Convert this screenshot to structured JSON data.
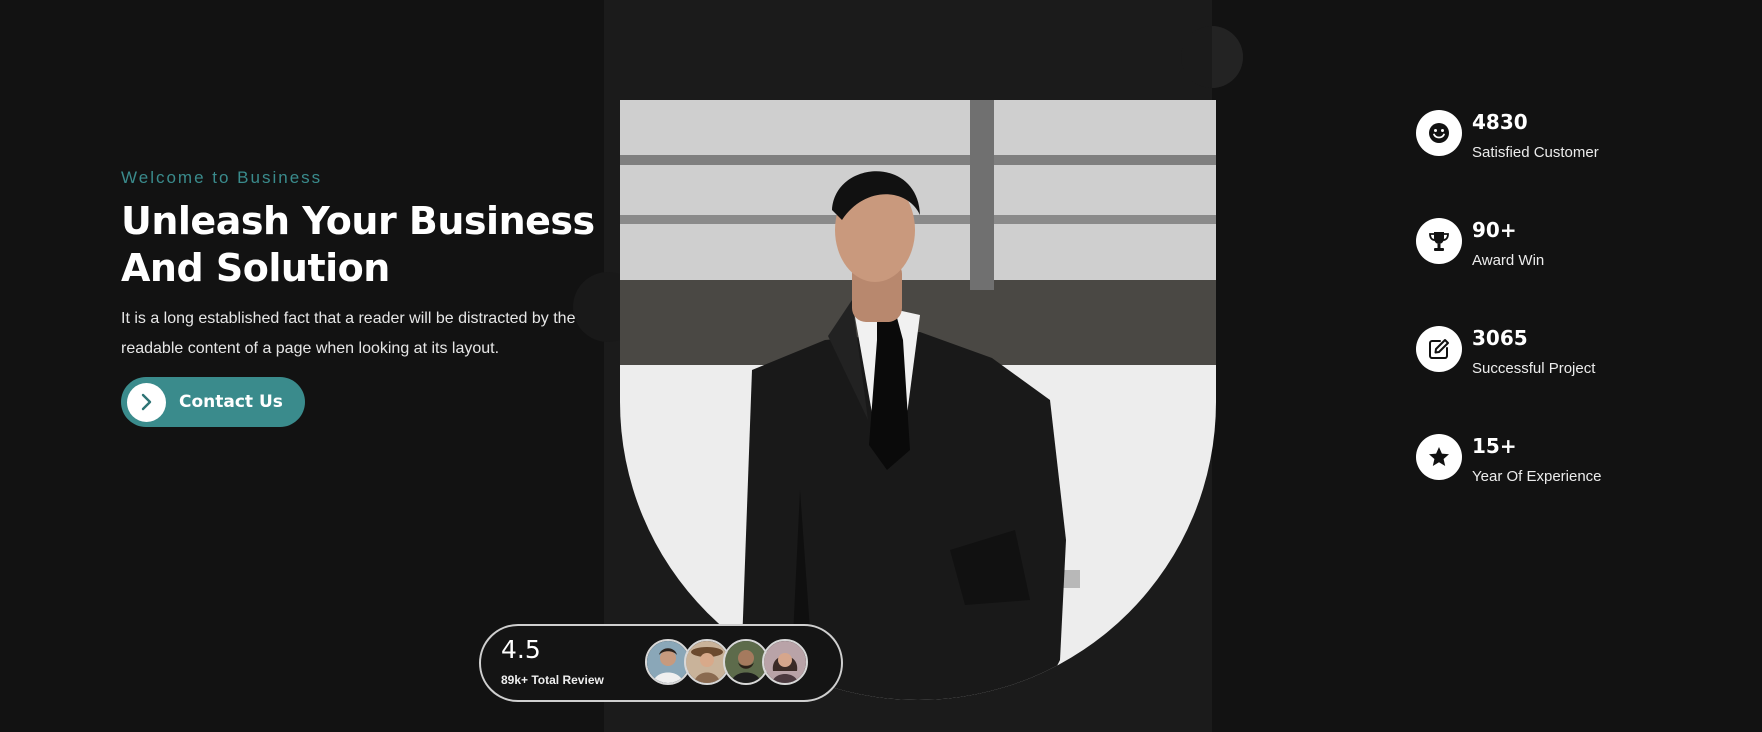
{
  "hero": {
    "eyebrow": "Welcome to Business",
    "title_line1": "Unleash Your Business",
    "title_line2": "And Solution",
    "description": "It is a long established fact that a reader will be distracted by the readable content of a page when looking at its layout.",
    "cta_label": "Contact Us"
  },
  "review": {
    "rating": "4.5",
    "subtitle": "89k+ Total Review"
  },
  "stats": [
    {
      "value": "4830",
      "label": "Satisfied Customer",
      "icon": "smiley-icon"
    },
    {
      "value": "90+",
      "label": "Award Win",
      "icon": "trophy-icon"
    },
    {
      "value": "3065",
      "label": "Successful Project",
      "icon": "edit-icon"
    },
    {
      "value": "15+",
      "label": "Year Of Experience",
      "icon": "star-icon"
    }
  ],
  "colors": {
    "accent": "#3a8b8c",
    "background": "#121212",
    "panel": "#1b1b1b"
  }
}
